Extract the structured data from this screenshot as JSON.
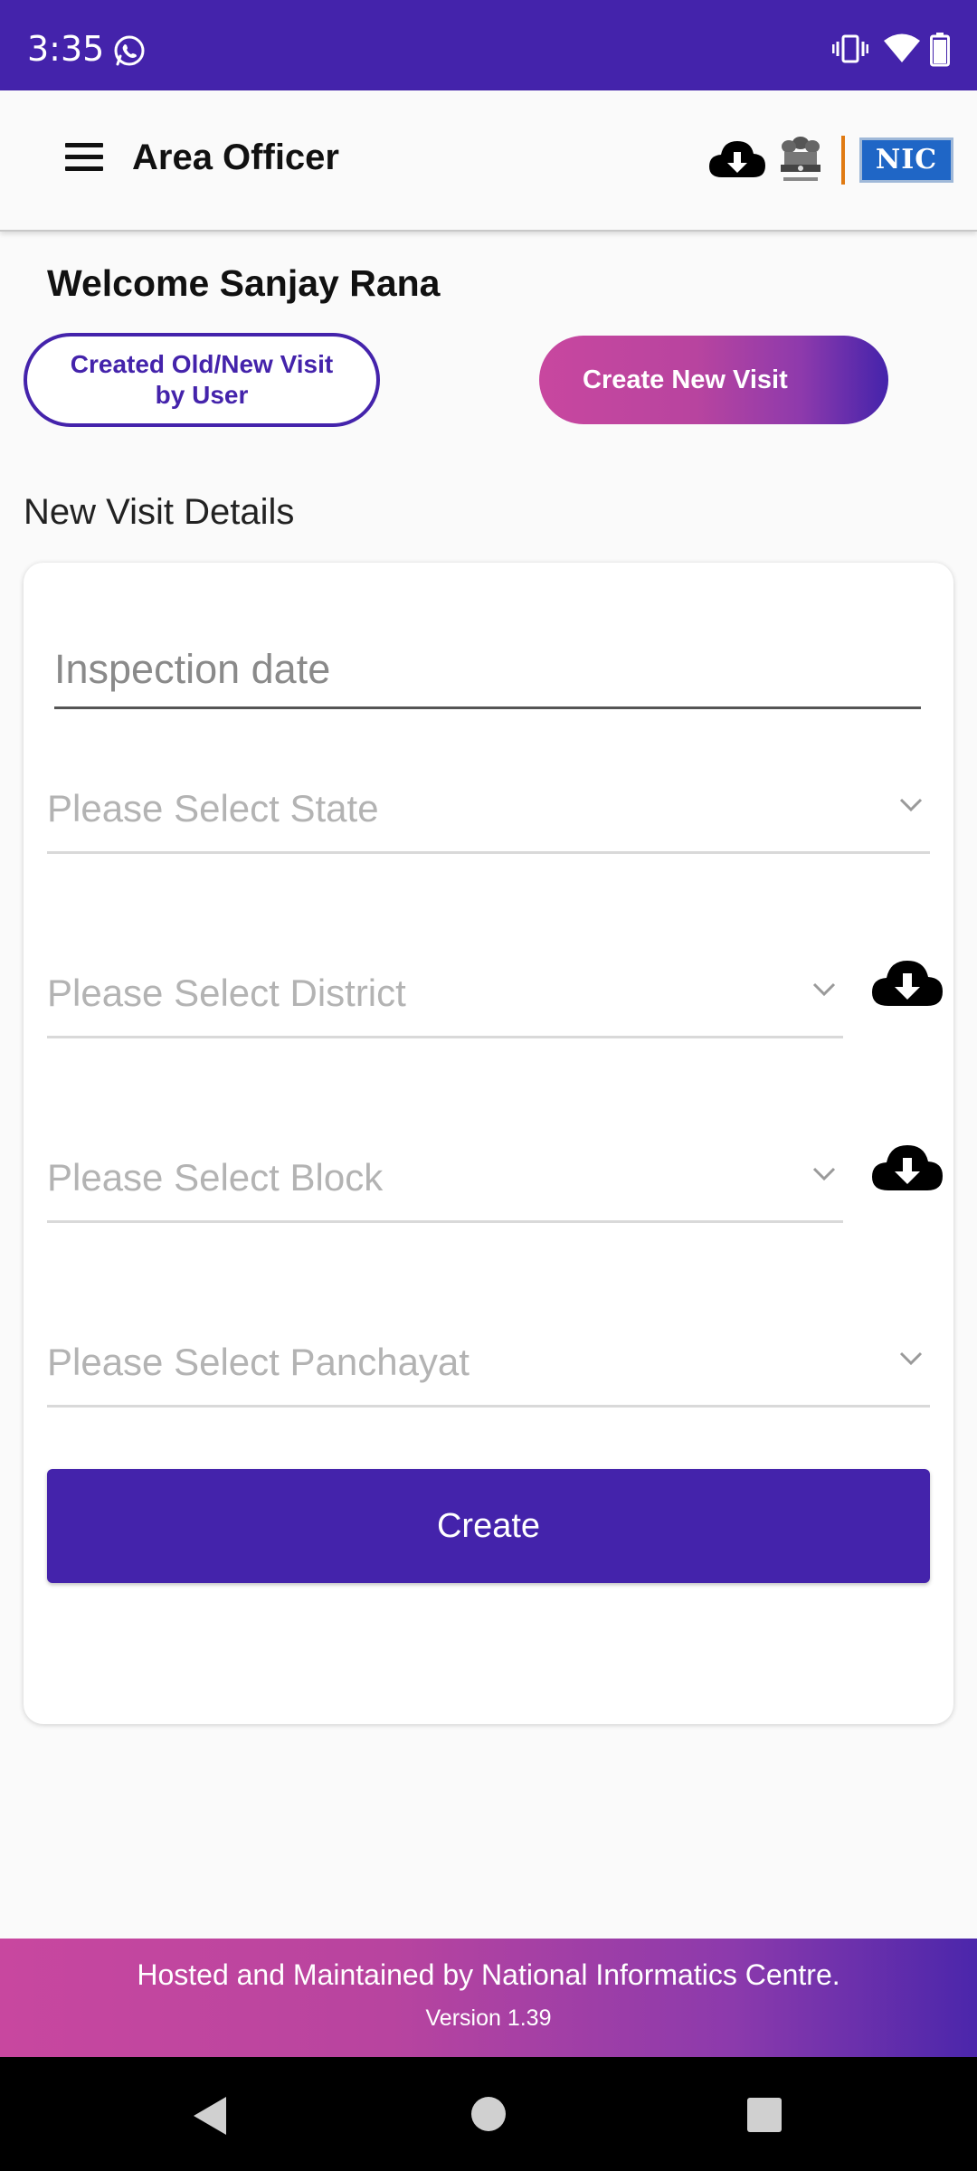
{
  "status_bar": {
    "time": "3:35",
    "icons": [
      "whatsapp-icon",
      "vibrate-icon",
      "wifi-icon",
      "battery-icon"
    ],
    "color": "#4423ab"
  },
  "app_bar": {
    "title": "Area Officer",
    "icons": [
      "menu-icon",
      "cloud-download-icon",
      "national-emblem-logo",
      "nic-logo"
    ],
    "nic_logo_text": "NIC"
  },
  "welcome": {
    "text": "Welcome Sanjay Rana"
  },
  "actions": {
    "created_visits_label": "Created Old/New Visit by User",
    "create_new_visit_label": "Create New Visit"
  },
  "form": {
    "section_title": "New Visit Details",
    "inspection_date_placeholder": "Inspection date",
    "state_placeholder": "Please Select State",
    "district_placeholder": "Please Select District",
    "block_placeholder": "Please Select Block",
    "panchayat_placeholder": "Please Select Panchayat",
    "create_label": "Create"
  },
  "footer": {
    "line1": "Hosted and Maintained by National Informatics Centre.",
    "line2": "Version 1.39"
  },
  "colors": {
    "primary": "#4423ab",
    "accent_pink": "#c8479f",
    "background": "#fafafa"
  }
}
